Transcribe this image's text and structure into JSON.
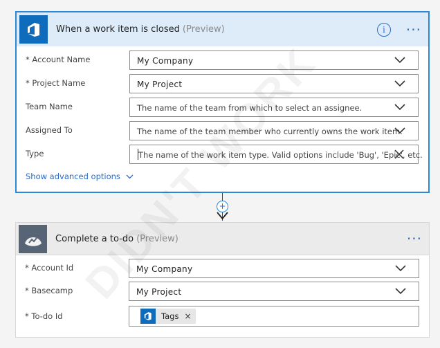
{
  "trigger": {
    "title": "When a work item is closed",
    "preview": "(Preview)",
    "info_icon": "i",
    "more_icon": "···",
    "accent": "#2b88d8",
    "fields": [
      {
        "label": "* Account Name",
        "value": "My Company",
        "placeholder": ""
      },
      {
        "label": "* Project Name",
        "value": "My Project",
        "placeholder": ""
      },
      {
        "label": "Team Name",
        "value": "",
        "placeholder": "The name of the team from which to select an assignee."
      },
      {
        "label": "Assigned To",
        "value": "",
        "placeholder": "The name of the team member who currently owns the work item."
      },
      {
        "label": "Type",
        "value": "",
        "placeholder": "The name of the work item type. Valid options include 'Bug', 'Epic', etc."
      }
    ],
    "advanced_link": "Show advanced options"
  },
  "connector": {
    "plus": "+"
  },
  "action": {
    "title": "Complete a to-do",
    "preview": "(Preview)",
    "more_icon": "···",
    "fields": [
      {
        "label": "* Account Id",
        "value": "My Company"
      },
      {
        "label": "* Basecamp",
        "value": "My Project"
      },
      {
        "label": "* To-do Id",
        "value": ""
      }
    ],
    "tag": {
      "label": "Tags",
      "remove": "×"
    }
  },
  "watermark": "DIDN'T WORK",
  "icons": [
    "azure-devops-logo-icon",
    "basecamp-logo-icon",
    "info-icon",
    "more-icon",
    "chevron-down-icon",
    "close-icon",
    "plus-icon",
    "arrow-down-icon"
  ]
}
